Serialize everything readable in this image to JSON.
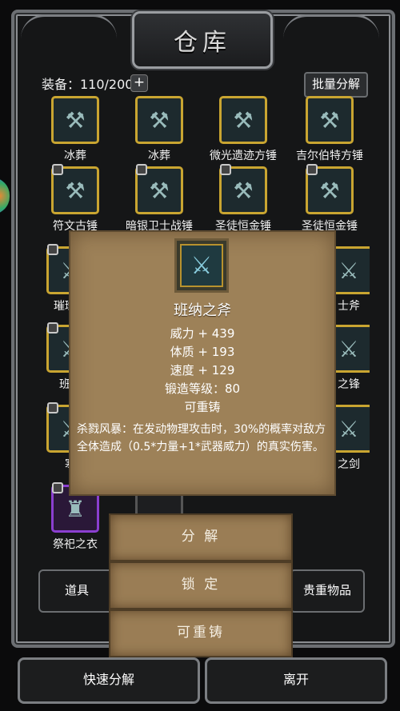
{
  "title": "仓库",
  "status": {
    "label": "装备：110/200",
    "plus": "+"
  },
  "batch_button": "批量分解",
  "items": [
    {
      "name": "冰葬",
      "glyph": "⚒",
      "border": "gold",
      "locked": false
    },
    {
      "name": "冰葬",
      "glyph": "⚒",
      "border": "gold",
      "locked": false
    },
    {
      "name": "微光遗迹方锤",
      "glyph": "⚒",
      "border": "gold",
      "locked": false
    },
    {
      "name": "吉尔伯特方锤",
      "glyph": "⚒",
      "border": "gold",
      "locked": false
    },
    {
      "name": "符文古锤",
      "glyph": "⚒",
      "border": "gold",
      "locked": true
    },
    {
      "name": "暗银卫士战锤",
      "glyph": "⚒",
      "border": "gold",
      "locked": true
    },
    {
      "name": "圣徒恒金锤",
      "glyph": "⚒",
      "border": "gold",
      "locked": true
    },
    {
      "name": "圣徒恒金锤",
      "glyph": "⚒",
      "border": "gold",
      "locked": true
    },
    {
      "name": "璀璨遗",
      "glyph": "⚔",
      "border": "gold",
      "locked": true
    },
    {
      "name": "士斧",
      "glyph": "⚔",
      "border": "gold",
      "locked": false
    },
    {
      "name": "班纳",
      "glyph": "⚔",
      "border": "gold",
      "locked": true
    },
    {
      "name": "之锋",
      "glyph": "⚔",
      "border": "gold",
      "locked": false
    },
    {
      "name": "寒",
      "glyph": "⚔",
      "border": "gold",
      "locked": true
    },
    {
      "name": "之剑",
      "glyph": "⚔",
      "border": "gold",
      "locked": false
    },
    {
      "name": "祭祀之衣",
      "glyph": "♜",
      "border": "purple",
      "locked": true
    }
  ],
  "popup": {
    "item_name": "班纳之斧",
    "stats": [
      "威力 + 439",
      "体质 + 193",
      "速度 + 129",
      "锻造等级：80",
      "可重铸"
    ],
    "description": "杀戮风暴：在发动物理攻击时，30%的概率对敌方全体造成（0.5*力量+1*武器威力）的真实伤害。"
  },
  "actions": [
    "分 解",
    "锁 定",
    "可重铸"
  ],
  "tabs": {
    "left": "道具",
    "right": "贵重物品"
  },
  "bottom": {
    "left": "快速分解",
    "right": "离开"
  }
}
